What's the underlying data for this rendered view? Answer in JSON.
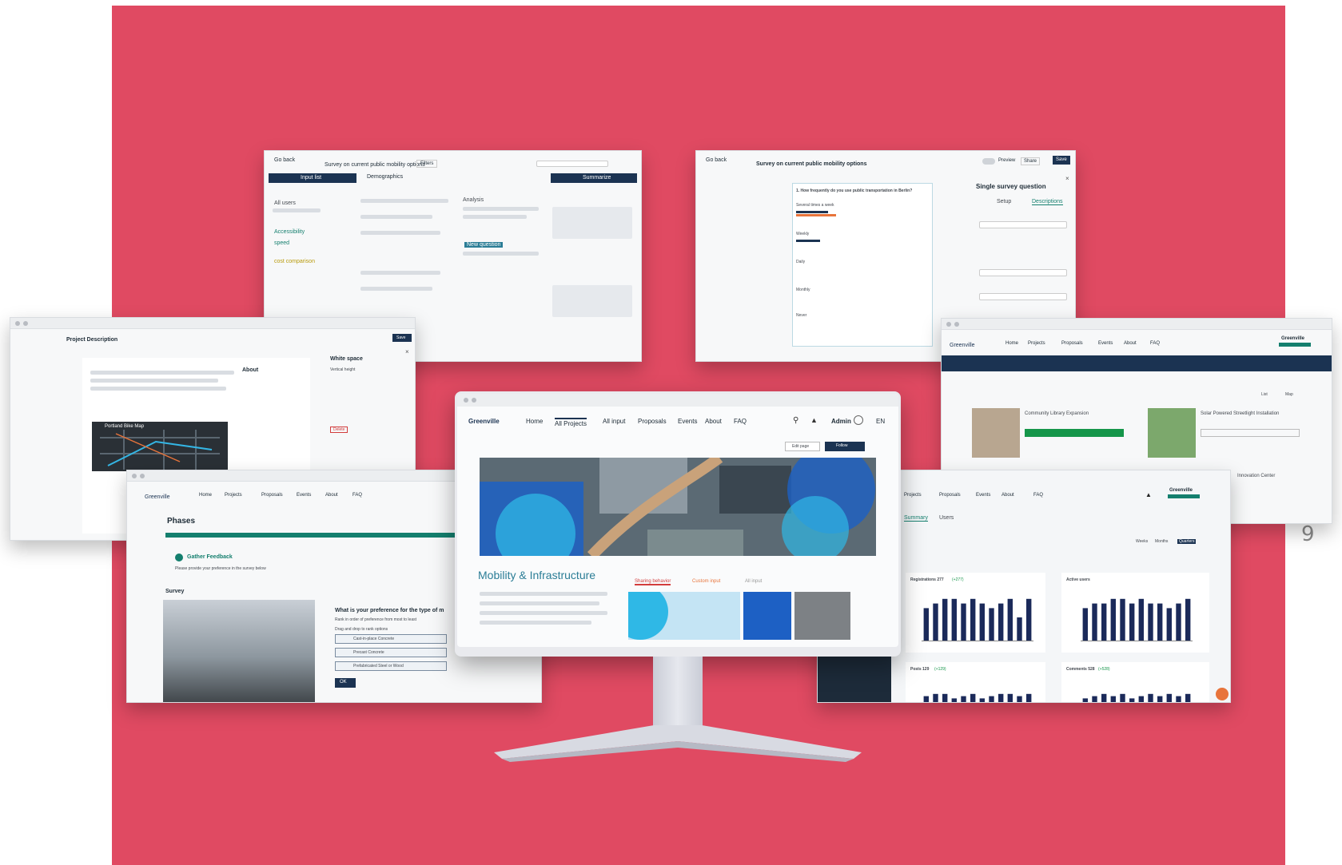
{
  "page_number": "9",
  "colors": {
    "backdrop": "#e04a62",
    "navy": "#1b3352",
    "teal": "#147f6e",
    "accent_blue": "#2b7d96"
  },
  "icons": [
    "search-icon",
    "bell-icon",
    "user-avatar-icon",
    "toggle-icon",
    "close-icon",
    "chevron-down-icon"
  ],
  "monitor": {
    "logo": "Greenville",
    "nav": [
      "Home",
      "All Projects",
      "All input",
      "Proposals",
      "Events",
      "About",
      "FAQ"
    ],
    "user": "Admin",
    "lang": "EN",
    "edit_button": "Edit page",
    "follow_button": "Follow",
    "section_title": "Mobility & Infrastructure",
    "cards": [
      "Sharing behavior",
      "Custom input",
      "All input"
    ]
  },
  "win_survey_results": {
    "back": "Go back",
    "title": "Survey on current public mobility options",
    "left_tab": "Input list",
    "mid_tab": "Demographics",
    "right_tab": "Summarize",
    "filters": "Filters",
    "labels": [
      "All users",
      "Accessibility",
      "speed",
      "cost comparison",
      "Analysis",
      "New question"
    ]
  },
  "win_survey_builder": {
    "back": "Go back",
    "title": "Survey on current public mobility options",
    "preview": "Preview",
    "share": "Share",
    "save": "Save",
    "panel_title": "Single survey question",
    "panel_tabs": [
      "Setup",
      "Descriptions"
    ],
    "question": "1. How frequently do you use public transportation in Berlin?",
    "options": [
      "Several times a week",
      "Weekly",
      "Daily",
      "Monthly",
      "Never"
    ]
  },
  "win_project_desc": {
    "title": "Project Description",
    "save": "Save",
    "about": "About",
    "map_title": "Portland Bike Map",
    "panel_title": "White space",
    "panel_sub": "Vertical height",
    "delete": "Delete"
  },
  "win_projects_list": {
    "logo": "Greenville",
    "nav": [
      "Home",
      "Projects",
      "Proposals",
      "Events",
      "About",
      "FAQ"
    ],
    "city": "Greenville",
    "cards": [
      "Community Library Expansion",
      "Solar Powered Streetlight Installation",
      "Innovation Center"
    ],
    "list": "List",
    "map": "Map"
  },
  "win_phases": {
    "logo": "Greenville",
    "nav": [
      "Home",
      "Projects",
      "Proposals",
      "Events",
      "About",
      "FAQ"
    ],
    "heading": "Phases",
    "phase_title": "Gather Feedback",
    "phase_desc": "Please provide your preference in the survey below",
    "survey_label": "Survey",
    "question": "What is your preference for the type of m",
    "hint": "Rank in order of preference from most to least",
    "drag_hint": "Drag and drop to rank options",
    "options": [
      "Cast-in-place Concrete",
      "Precast Concrete",
      "Prefabricated Steel or Wood"
    ],
    "ok": "OK"
  },
  "win_dashboard": {
    "nav": [
      "Projects",
      "Proposals",
      "Events",
      "About",
      "FAQ"
    ],
    "city": "Greenville",
    "tabs": [
      "Summary",
      "Users"
    ],
    "ranges": [
      "Weeks",
      "Months",
      "Quarters"
    ],
    "charts": [
      {
        "title": "Registrations 277",
        "delta": "(+277)"
      },
      {
        "title": "Active users",
        "delta": ""
      },
      {
        "title": "Posts 129",
        "delta": "(+129)"
      },
      {
        "title": "Comments 528",
        "delta": "(+528)"
      }
    ]
  },
  "chart_data": [
    {
      "type": "bar",
      "title": "Registrations 277",
      "values": [
        7,
        8,
        9,
        9,
        8,
        9,
        8,
        7,
        8,
        9,
        5,
        9
      ]
    },
    {
      "type": "bar",
      "title": "Active users",
      "values": [
        7,
        8,
        8,
        9,
        9,
        8,
        9,
        8,
        8,
        7,
        8,
        9
      ]
    },
    {
      "type": "bar",
      "title": "Posts 129",
      "values": [
        3,
        4,
        4,
        2,
        3,
        4,
        2,
        3,
        4,
        4,
        3,
        4
      ]
    },
    {
      "type": "bar",
      "title": "Comments 528",
      "values": [
        2,
        3,
        4,
        3,
        4,
        2,
        3,
        4,
        3,
        4,
        3,
        4
      ]
    }
  ]
}
